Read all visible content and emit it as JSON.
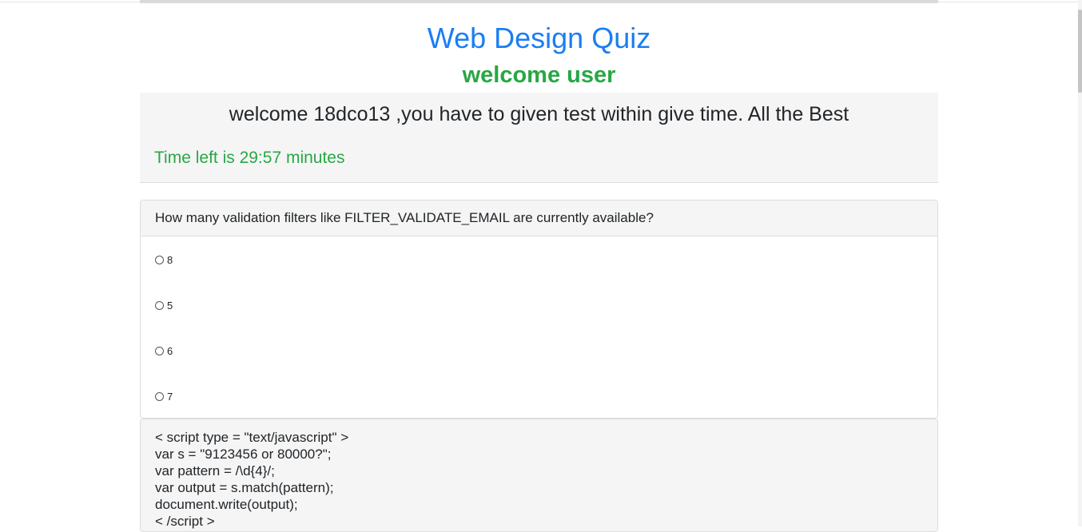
{
  "quiz": {
    "title": "Web Design Quiz",
    "welcome_user": "welcome user",
    "welcome_message": "welcome 18dco13 ,you have to given test within give time. All the Best",
    "timer": "Time left is 29:57 minutes"
  },
  "question": {
    "text": "How many validation filters like FILTER_VALIDATE_EMAIL are currently available?",
    "options": [
      "8",
      "5",
      "6",
      "7"
    ]
  },
  "next_question": {
    "code_lines": [
      "< script type = \"text/javascript\" >",
      "var s = \"9123456 or 80000?\";",
      "var pattern = /\\d{4}/;",
      "var output = s.match(pattern);",
      "document.write(output);",
      "< /script >"
    ]
  },
  "colors": {
    "title": "#1a7ef2",
    "success": "#28a745",
    "panel_bg": "#f5f5f5"
  }
}
